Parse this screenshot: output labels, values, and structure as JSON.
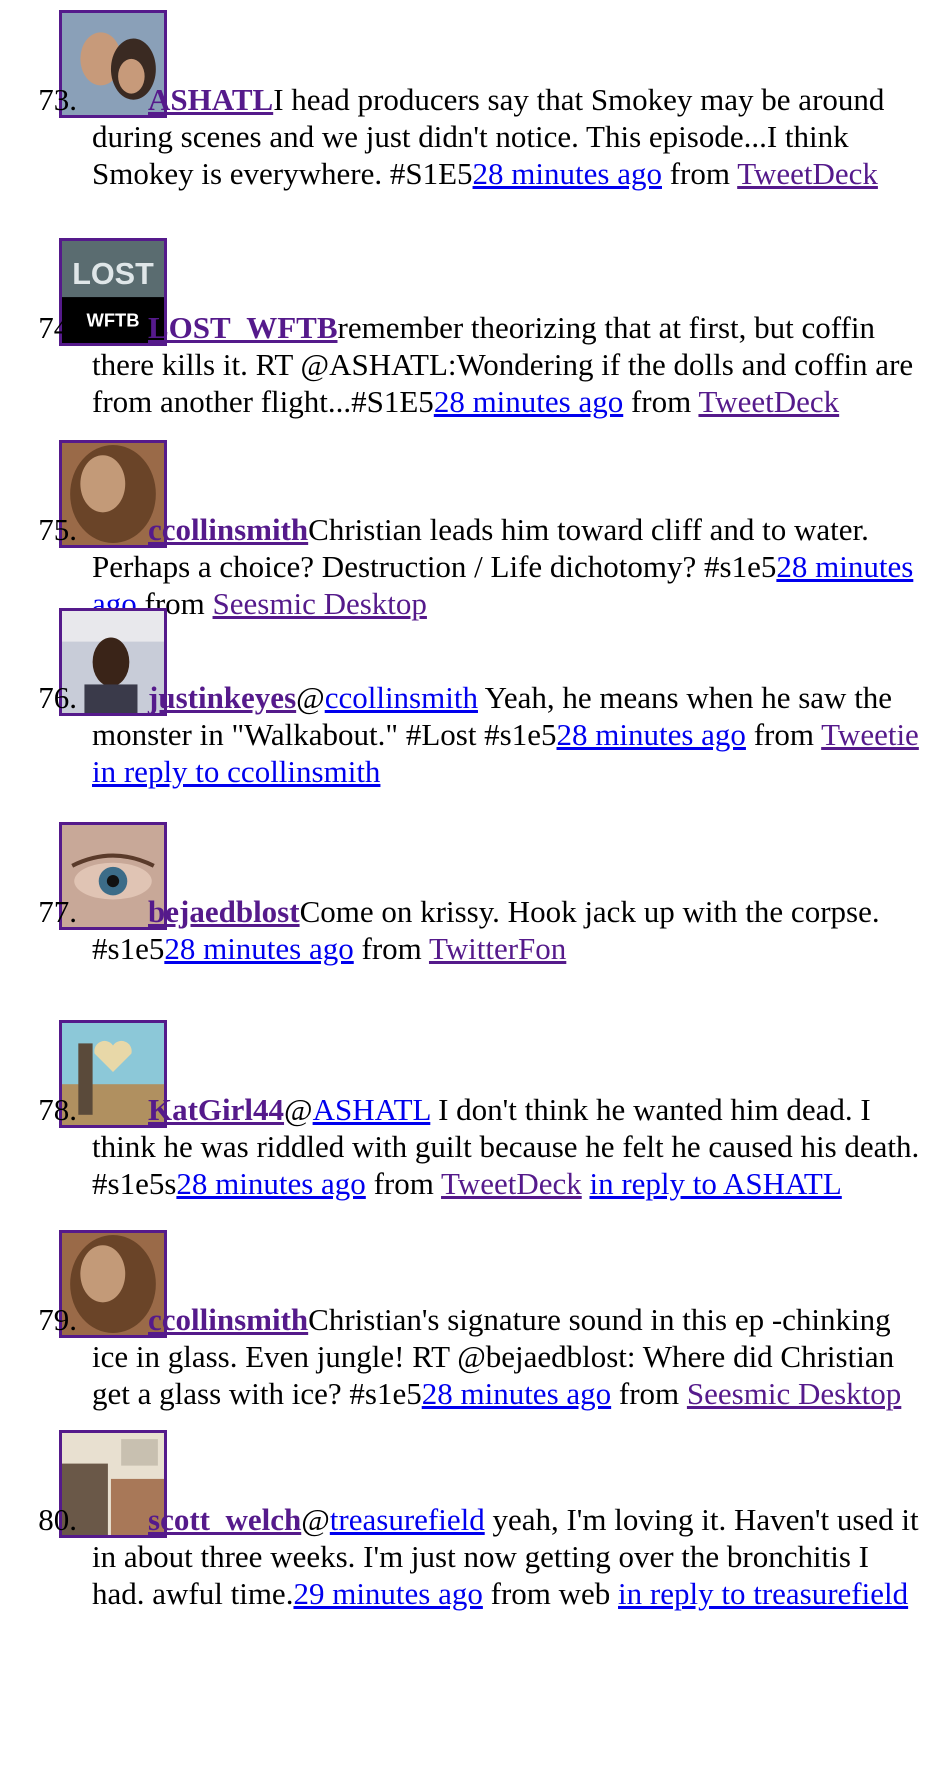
{
  "tweets": [
    {
      "num": "73.",
      "user": "ASHATL",
      "pre": "",
      "mention": "",
      "text": "I head producers say that Smokey may be around during scenes and we just didn't notice. This episode...I think Smokey is everywhere. #S1E5",
      "time": "28 minutes ago",
      "from": "from",
      "source": "TweetDeck",
      "reply": "",
      "avatar": "couple-photo",
      "colors": [
        "#8aa0b8",
        "#3a2a22",
        "#c79a7a"
      ]
    },
    {
      "num": "74.",
      "user": "LOST_WFTB",
      "pre": "",
      "mention": "",
      "text": "remember theorizing that at first, but coffin there kills it. RT @ASHATL:Wondering if the dolls and coffin are from another flight...#S1E5",
      "time": "28 minutes ago",
      "from": "from",
      "source": "TweetDeck",
      "reply": "",
      "avatar": "lost-logo",
      "logo_top": "LOST",
      "logo_bottom": "WFTB",
      "colors": [
        "#5a6c70",
        "#000000",
        "#ffffff"
      ]
    },
    {
      "num": "75.",
      "user": "ccollinsmith",
      "pre": "",
      "mention": "",
      "text": "Christian leads him toward cliff and to water. Perhaps a choice? Destruction / Life dichotomy? #s1e5",
      "time": "28 minutes ago",
      "from": "from",
      "source": "Seesmic Desktop",
      "reply": "",
      "avatar": "hair-photo",
      "colors": [
        "#9a6a48",
        "#6a4428",
        "#c39a78"
      ]
    },
    {
      "num": "76.",
      "user": "justinkeyes",
      "pre": "@",
      "mention": "ccollinsmith",
      "text": " Yeah, he means when he saw the monster in \"Walkabout.\" #Lost #s1e5",
      "time": "28 minutes ago",
      "from": "from",
      "source": "Tweetie",
      "reply": "in reply to ccollinsmith",
      "avatar": "man-photo",
      "colors": [
        "#c8ccd8",
        "#3a2418",
        "#e8e8ec"
      ]
    },
    {
      "num": "77.",
      "user": "bejaedblost",
      "pre": "",
      "mention": "",
      "text": "Come on krissy. Hook jack up with the corpse. #s1e5",
      "time": "28 minutes ago",
      "from": "from",
      "source": "TwitterFon",
      "reply": "",
      "avatar": "eye-photo",
      "colors": [
        "#c8a898",
        "#3c6c88",
        "#e0c4b4"
      ]
    },
    {
      "num": "78.",
      "user": "KatGirl44",
      "pre": "@",
      "mention": "ASHATL",
      "text": " I don't think he wanted him dead. I think he was riddled with guilt because he felt he caused his death. #s1e5s",
      "time": "28 minutes ago",
      "from": "from",
      "source": "TweetDeck",
      "reply": "in reply to ASHATL",
      "avatar": "heart-photo",
      "colors": [
        "#8cc8d8",
        "#e8d8a8",
        "#b09060"
      ]
    },
    {
      "num": "79.",
      "user": "ccollinsmith",
      "pre": "",
      "mention": "",
      "text": "Christian's signature sound in this ep -chinking ice in glass. Even jungle! RT @bejaedblost: Where did Christian get a glass with ice? #s1e5",
      "time": "28 minutes ago",
      "from": "from",
      "source": "Seesmic Desktop",
      "reply": "",
      "avatar": "hair-photo",
      "colors": [
        "#9a6a48",
        "#6a4428",
        "#c39a78"
      ]
    },
    {
      "num": "80.",
      "user": "scott_welch",
      "pre": "@",
      "mention": "treasurefield",
      "text": " yeah, I'm loving it. Haven't used it in about three weeks. I'm just now getting over the bronchitis I had. awful time.",
      "time": "29 minutes ago",
      "from": "from web",
      "source": "",
      "reply": "in reply to treasurefield",
      "avatar": "poster-photo",
      "colors": [
        "#c8c0b0",
        "#6a5848",
        "#e8e0d0"
      ]
    }
  ]
}
